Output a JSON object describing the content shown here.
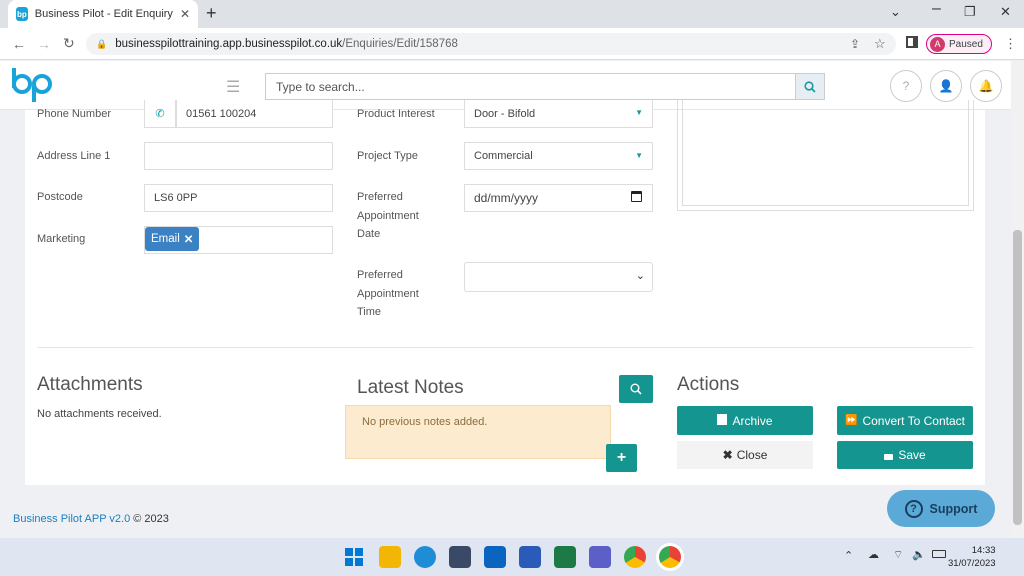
{
  "browser": {
    "tab_title": "Business Pilot - Edit Enquiry",
    "url_host": "businesspilottraining.app.businesspilot.co.uk",
    "url_path": "/Enquiries/Edit/158768",
    "profile_initial": "A",
    "profile_status": "Paused"
  },
  "header": {
    "logo_text": "bp",
    "search_placeholder": "Type to search..."
  },
  "form": {
    "phone_label": "Phone Number",
    "phone_value": "01561 100204",
    "address_label": "Address Line 1",
    "address_value": "",
    "postcode_label": "Postcode",
    "postcode_value": "LS6 0PP",
    "marketing_label": "Marketing",
    "marketing_tag": "Email",
    "product_label": "Product Interest",
    "product_value": "Door - Bifold",
    "project_label": "Project Type",
    "project_value": "Commercial",
    "pref_date_label_1": "Preferred",
    "pref_date_label_2": "Appointment",
    "pref_date_label_3": "Date",
    "pref_date_placeholder": "dd/mm/yyyy",
    "pref_time_label_1": "Preferred",
    "pref_time_label_2": "Appointment",
    "pref_time_label_3": "Time",
    "pref_time_value": ""
  },
  "attachments": {
    "title": "Attachments",
    "empty": "No attachments received."
  },
  "notes": {
    "title": "Latest Notes",
    "empty": "No previous notes added."
  },
  "actions": {
    "title": "Actions",
    "archive": "Archive",
    "convert": "Convert To Contact",
    "close": "Close",
    "save": "Save"
  },
  "footer": {
    "brand": "Business Pilot APP v2.0",
    "copyright": "© 2023",
    "support": "Support"
  },
  "taskbar": {
    "time": "14:33",
    "date": "31/07/2023"
  },
  "colors": {
    "teal": "#14958f",
    "brand_blue": "#1aa3d9",
    "tag_blue": "#3b82c4",
    "notes_bg": "#fdebcf"
  }
}
